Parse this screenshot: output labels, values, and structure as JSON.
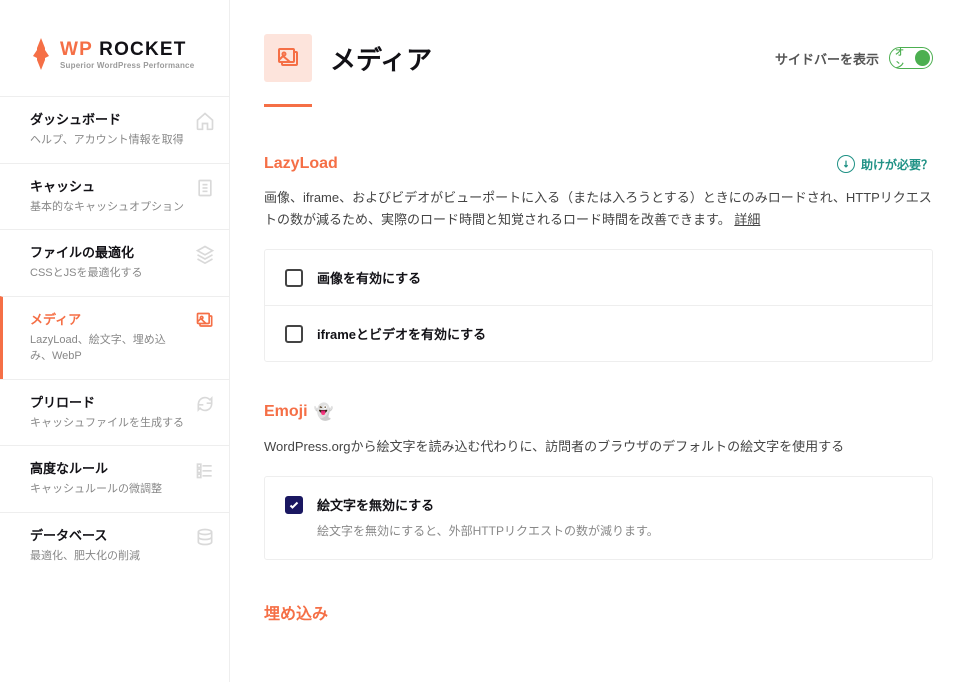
{
  "logo": {
    "wp": "WP",
    "rocket": "ROCKET",
    "tagline": "Superior WordPress Performance"
  },
  "nav": [
    {
      "title": "ダッシュボード",
      "desc": "ヘルプ、アカウント情報を取得",
      "active": false
    },
    {
      "title": "キャッシュ",
      "desc": "基本的なキャッシュオプション",
      "active": false
    },
    {
      "title": "ファイルの最適化",
      "desc": "CSSとJSを最適化する",
      "active": false
    },
    {
      "title": "メディア",
      "desc": "LazyLoad、絵文字、埋め込み、WebP",
      "active": true
    },
    {
      "title": "プリロード",
      "desc": "キャッシュファイルを生成する",
      "active": false
    },
    {
      "title": "高度なルール",
      "desc": "キャッシュルールの微調整",
      "active": false
    },
    {
      "title": "データベース",
      "desc": "最適化、肥大化の削減",
      "active": false
    }
  ],
  "page": {
    "title": "メディア",
    "sidebar_toggle": "サイドバーを表示",
    "toggle_on": "オン"
  },
  "help_link": "助けが必要？",
  "sections": {
    "lazyload": {
      "title": "LazyLoad",
      "desc": "画像、iframe、およびビデオがビューポートに入る（または入ろうとする）ときにのみロードされ、HTTPリクエストの数が減るため、実際のロード時間と知覚されるロード時間を改善できます。",
      "more": "詳細",
      "opt1": "画像を有効にする",
      "opt2": "iframeとビデオを有効にする"
    },
    "emoji": {
      "title": "Emoji",
      "icon": "👻",
      "desc": "WordPress.orgから絵文字を読み込む代わりに、訪問者のブラウザのデフォルトの絵文字を使用する",
      "opt1": "絵文字を無効にする",
      "opt1_desc": "絵文字を無効にすると、外部HTTPリクエストの数が減ります。"
    },
    "embed": {
      "title": "埋め込み"
    }
  }
}
